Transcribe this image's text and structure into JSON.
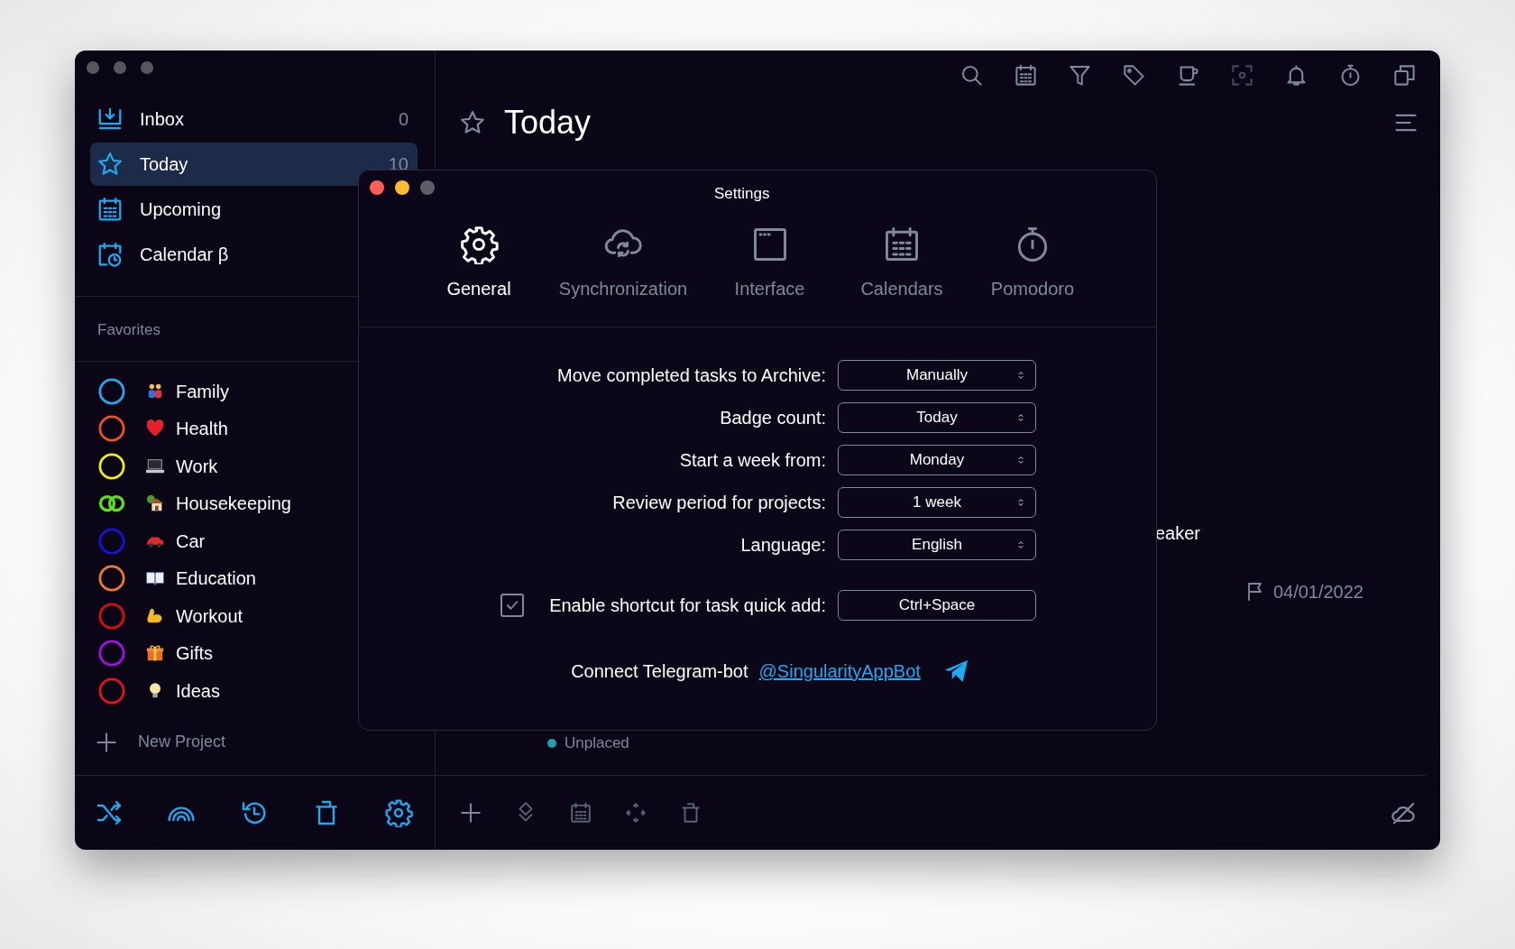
{
  "sidebar": {
    "nav": [
      {
        "label": "Inbox",
        "count": "0",
        "selected": false
      },
      {
        "label": "Today",
        "count": "10",
        "selected": true
      },
      {
        "label": "Upcoming",
        "selected": false
      },
      {
        "label": "Calendar β",
        "selected": false
      }
    ],
    "favorites_heading": "Favorites",
    "projects": [
      {
        "name": "Family",
        "kind": "ring",
        "color": "#27a9ef"
      },
      {
        "name": "Health",
        "kind": "ring",
        "color": "#f0521c"
      },
      {
        "name": "Work",
        "kind": "ring",
        "color": "#f2ee10"
      },
      {
        "name": "Housekeeping",
        "kind": "linked",
        "color": "#5ee01e"
      },
      {
        "name": "Car",
        "kind": "ring",
        "color": "#1414e0"
      },
      {
        "name": "Education",
        "kind": "ring",
        "color": "#f27a30"
      },
      {
        "name": "Workout",
        "kind": "ring",
        "color": "#d90f0f"
      },
      {
        "name": "Gifts",
        "kind": "ring",
        "color": "#a310e8"
      },
      {
        "name": "Ideas",
        "kind": "ring",
        "color": "#e3141a"
      }
    ],
    "new_project": "New Project"
  },
  "main": {
    "title": "Today",
    "tasks": [
      {
        "kind": "title",
        "text": "eaker"
      },
      {
        "kind": "deadline",
        "text": "04/01/2022"
      },
      {
        "kind": "project",
        "text": "Unplaced",
        "color": "#1c9fb0"
      }
    ]
  },
  "settings_dialog": {
    "title": "Settings",
    "tabs": [
      {
        "label": "General",
        "selected": true
      },
      {
        "label": "Synchronization",
        "selected": false
      },
      {
        "label": "Interface",
        "selected": false
      },
      {
        "label": "Calendars",
        "selected": false
      },
      {
        "label": "Pomodoro",
        "selected": false
      }
    ],
    "fields": [
      {
        "label": "Move completed tasks to Archive:",
        "value": "Manually"
      },
      {
        "label": "Badge count:",
        "value": "Today"
      },
      {
        "label": "Start a week from:",
        "value": "Monday"
      },
      {
        "label": "Review period for projects:",
        "value": "1 week"
      },
      {
        "label": "Language:",
        "value": "English"
      }
    ],
    "shortcut": {
      "label": "Enable shortcut for task quick add:",
      "checked": true,
      "value": "Ctrl+Space"
    },
    "telegram": {
      "text": "Connect Telegram-bot",
      "link": "@SingularityAppBot"
    }
  }
}
